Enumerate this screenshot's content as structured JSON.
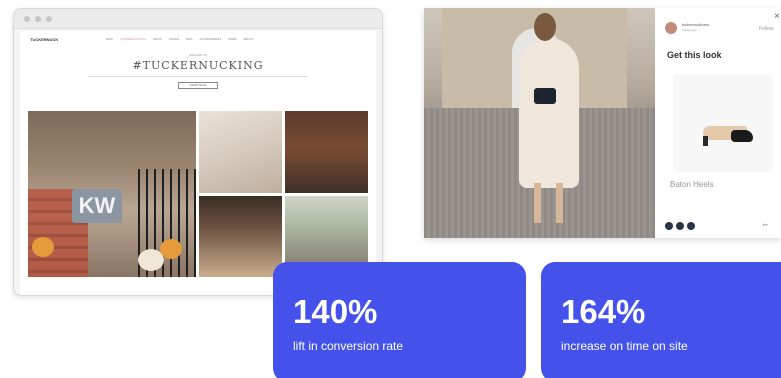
{
  "website": {
    "logo": "TUCKERNUCK",
    "nav": [
      "NEW",
      "TUCKERNUCKING",
      "SHOP",
      "SHOES",
      "BAG",
      "ACCESSORIES",
      "SWIM",
      "ABOUT"
    ],
    "eyebrow": "FOLLOW US",
    "title": "#TUCKERNUCKING",
    "button": "SHOP NOW",
    "bag_monogram": "KW"
  },
  "shoppable_post": {
    "username": "tuckernuckhers",
    "posted": "3 days ago",
    "follow": "Follow",
    "heading": "Get this look",
    "product_name": "Baton Heels"
  },
  "stats": [
    {
      "value": "140%",
      "label": "lift in conversion rate"
    },
    {
      "value": "164%",
      "label": "increase on time on site"
    }
  ],
  "colors": {
    "stat_card": "#4452eb",
    "stat_text": "#ffffff"
  }
}
